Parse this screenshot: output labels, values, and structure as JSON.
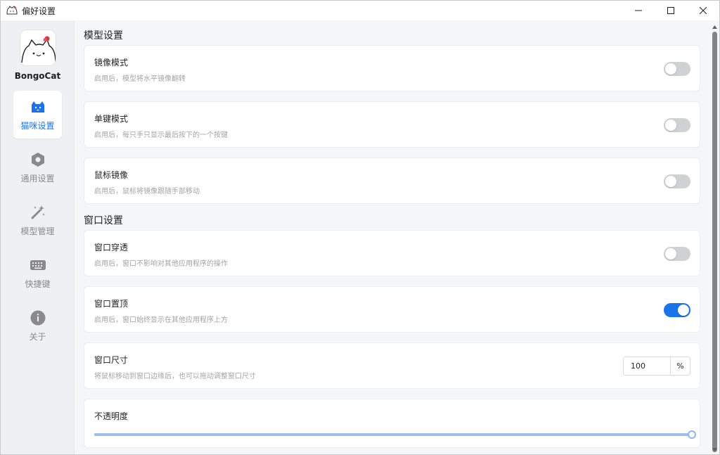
{
  "window": {
    "title": "偏好设置"
  },
  "sidebar": {
    "app_name": "BongoCat",
    "items": [
      {
        "label": "猫咪设置",
        "icon": "cat-icon",
        "active": true
      },
      {
        "label": "通用设置",
        "icon": "hexagon-settings-icon",
        "active": false
      },
      {
        "label": "模型管理",
        "icon": "magic-wand-icon",
        "active": false
      },
      {
        "label": "快捷键",
        "icon": "keyboard-icon",
        "active": false
      },
      {
        "label": "关于",
        "icon": "info-icon",
        "active": false
      }
    ]
  },
  "sections": {
    "model": {
      "title": "模型设置",
      "mirror": {
        "title": "镜像模式",
        "desc": "启用后，模型将水平镜像翻转",
        "enabled": false
      },
      "single_key": {
        "title": "单键模式",
        "desc": "启用后，每只手只显示最后按下的一个按键",
        "enabled": false
      },
      "mouse_mirror": {
        "title": "鼠标镜像",
        "desc": "启用后，鼠标将镜像跟随手部移动",
        "enabled": false
      }
    },
    "window": {
      "title": "窗口设置",
      "passthrough": {
        "title": "窗口穿透",
        "desc": "启用后，窗口不影响对其他应用程序的操作",
        "enabled": false
      },
      "always_on_top": {
        "title": "窗口置顶",
        "desc": "启用后，窗口始终显示在其他应用程序上方",
        "enabled": true
      },
      "size": {
        "title": "窗口尺寸",
        "desc": "将鼠标移动到窗口边缘后，也可以拖动调整窗口尺寸",
        "value": "100",
        "unit": "%"
      },
      "opacity": {
        "title": "不透明度",
        "value_percent": 100
      }
    }
  },
  "colors": {
    "accent": "#1a73e8",
    "toggle_off": "#cfd1d4"
  }
}
